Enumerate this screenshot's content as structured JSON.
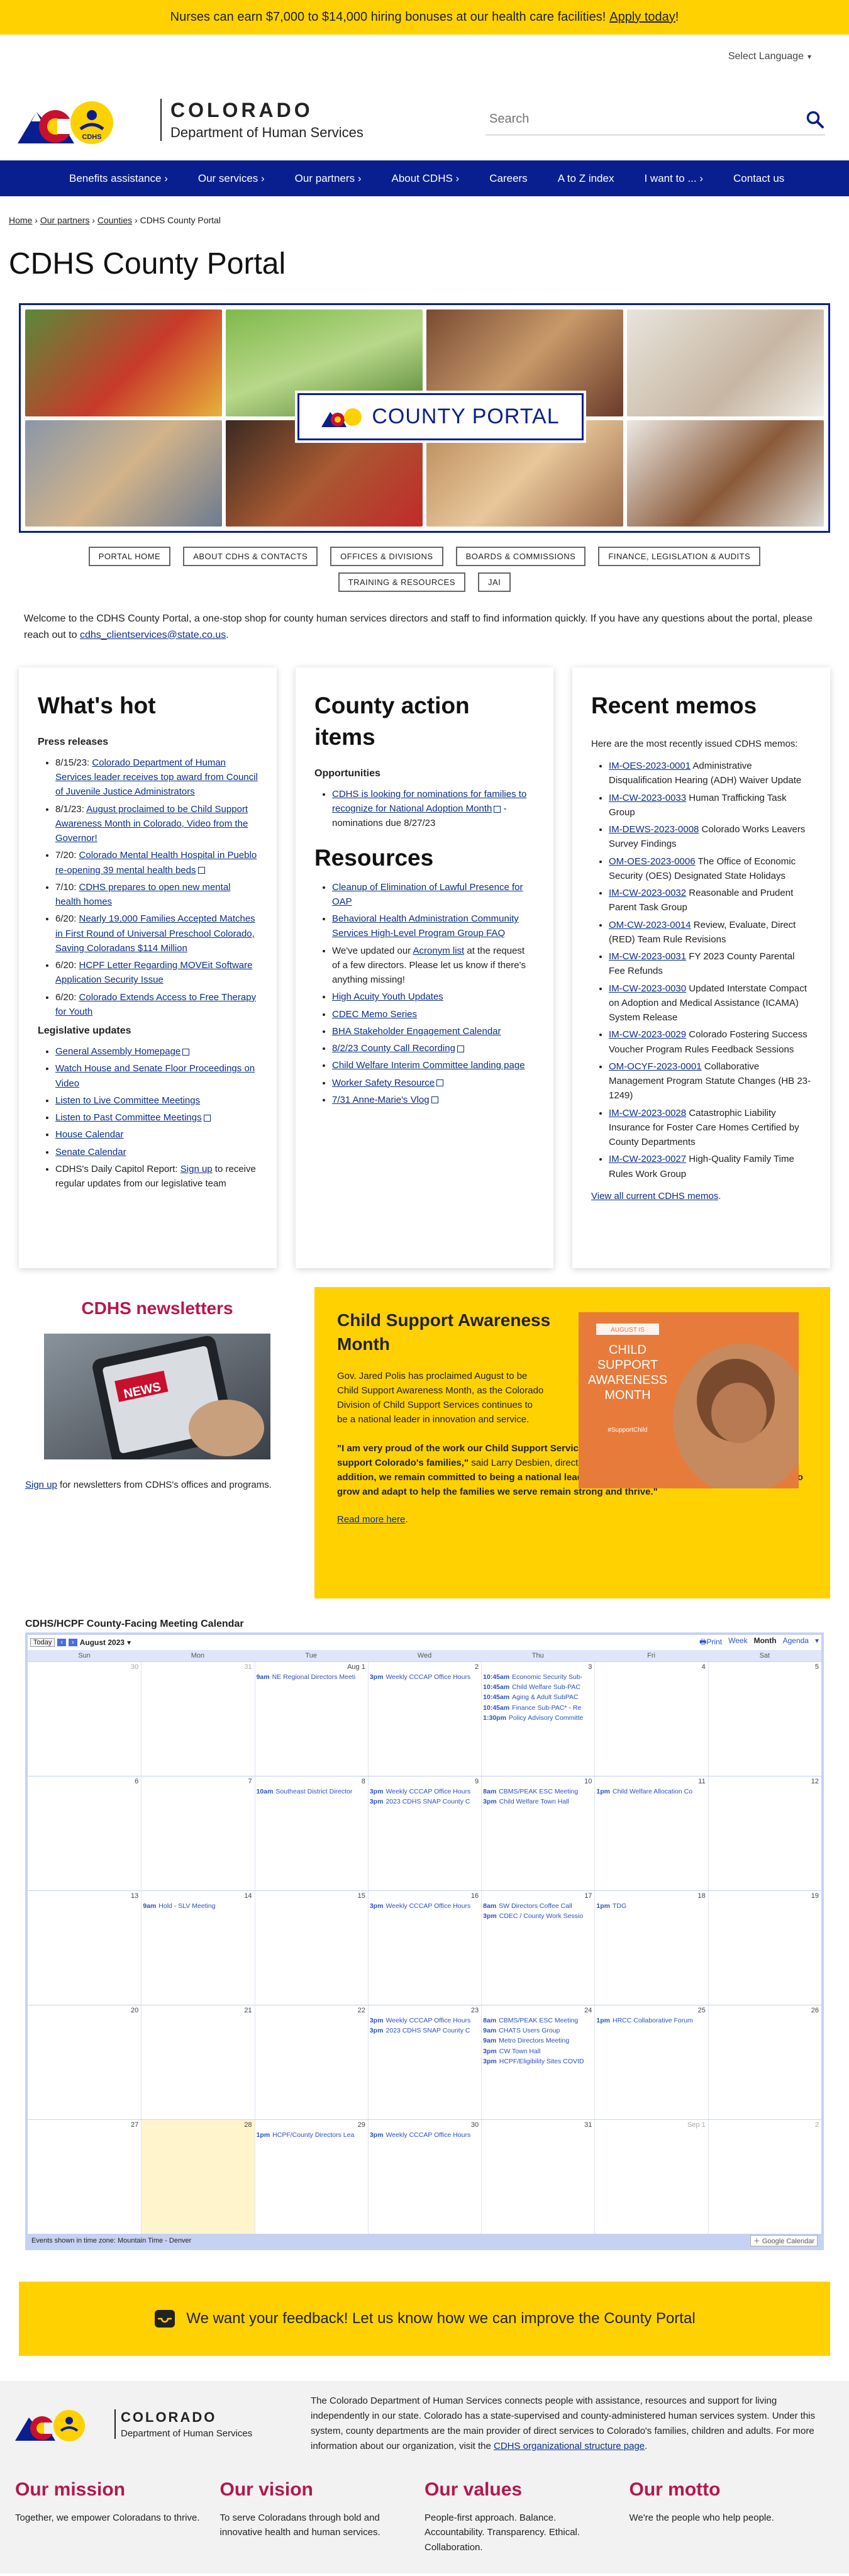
{
  "banner": {
    "text": "Nurses can earn $7,000 to $14,000 hiring bonuses at our health care facilities!",
    "link": "Apply today",
    "suffix": "!"
  },
  "language": {
    "label": "Select Language"
  },
  "logo": {
    "state": "COLORADO",
    "dept": "Department of Human Services",
    "badge": "CDHS"
  },
  "search": {
    "placeholder": "Search"
  },
  "nav": [
    "Benefits assistance",
    "Our services",
    "Our partners",
    "About CDHS",
    "Careers",
    "A to Z index",
    "I want to ...",
    "Contact us"
  ],
  "breadcrumb": {
    "home": "Home",
    "partners": "Our partners",
    "counties": "Counties",
    "current": "CDHS County Portal"
  },
  "page_title": "CDHS County Portal",
  "hero": {
    "badge": "COUNTY PORTAL"
  },
  "tabs": [
    "PORTAL HOME",
    "ABOUT CDHS & CONTACTS",
    "OFFICES & DIVISIONS",
    "BOARDS & COMMISSIONS",
    "FINANCE, LEGISLATION & AUDITS",
    "TRAINING & RESOURCES",
    "JAI"
  ],
  "intro": {
    "text": "Welcome to the CDHS County Portal, a one-stop shop for county human services directors and staff to find information quickly. If you have any questions about the portal, please reach out to ",
    "email": "cdhs_clientservices@state.co.us",
    "end": "."
  },
  "whats_hot": {
    "title": "What's hot",
    "press_heading": "Press releases",
    "press": [
      {
        "date": "8/15/23: ",
        "link": "Colorado Department of Human Services leader receives top award from Council of Juvenile Justice Administrators"
      },
      {
        "date": "8/1/23: ",
        "link": "August proclaimed to be Child Support Awareness Month in Colorado, Video from the Governor!"
      },
      {
        "date": "7/20: ",
        "link": "Colorado Mental Health Hospital in Pueblo re-opening 39 mental health beds"
      },
      {
        "date": "7/10: ",
        "link": "CDHS prepares to open new mental health homes"
      },
      {
        "date": "6/20: ",
        "link": "Nearly 19,000 Families Accepted Matches in First Round of Universal Preschool Colorado, Saving Coloradans $114 Million"
      },
      {
        "date": "6/20: ",
        "link": "HCPF Letter Regarding MOVEit Software Application Security Issue"
      },
      {
        "date": "6/20: ",
        "link": "Colorado Extends Access to Free Therapy for Youth"
      }
    ],
    "leg_heading": "Legislative updates",
    "leg": [
      "General Assembly Homepage",
      "Watch House and Senate Floor Proceedings on Video",
      "Listen to Live Committee Meetings",
      "Listen to Past Committee Meetings",
      "House Calendar",
      "Senate Calendar"
    ],
    "leg_tail": {
      "pre": "CDHS's Daily Capitol Report: ",
      "link": "Sign up",
      "post": " to receive regular updates from our legislative team"
    }
  },
  "county_action": {
    "title": "County action items",
    "opp_heading": "Opportunities",
    "opp_link": "CDHS is looking for nominations for families to recognize for National Adoption Month",
    "opp_tail": " - nominations due 8/27/23",
    "res_title": "Resources",
    "res": [
      "Cleanup of Elimination of Lawful Presence for OAP",
      "Behavioral Health Administration Community Services High-Level Program Group FAQ"
    ],
    "acr_pre": "We've updated our ",
    "acr_link": "Acronym list",
    "acr_post": " at the request of a few directors. Please let us know if there's anything missing!",
    "res2": [
      "High Acuity Youth Updates",
      "CDEC Memo Series",
      "BHA Stakeholder Engagement Calendar",
      "8/2/23 County Call Recording",
      "Child Welfare Interim Committee landing page",
      "Worker Safety Resource",
      "7/31 Anne-Marie's Vlog"
    ]
  },
  "memos": {
    "title": "Recent memos",
    "intro": "Here are the most recently issued CDHS memos:",
    "items": [
      {
        "id": "IM-OES-2023-0001",
        "text": " Administrative Disqualification Hearing (ADH) Waiver Update"
      },
      {
        "id": "IM-CW-2023-0033",
        "text": " Human Trafficking Task Group"
      },
      {
        "id": "IM-DEWS-2023-0008",
        "text": " Colorado Works Leavers Survey Findings"
      },
      {
        "id": "OM-OES-2023-0006",
        "text": " The Office of Economic Security (OES) Designated State Holidays"
      },
      {
        "id": "IM-CW-2023-0032",
        "text": " Reasonable and Prudent Parent Task Group"
      },
      {
        "id": "OM-CW-2023-0014",
        "text": " Review, Evaluate, Direct (RED) Team Rule Revisions"
      },
      {
        "id": "IM-CW-2023-0031",
        "text": " FY 2023 County Parental Fee Refunds"
      },
      {
        "id": "IM-CW-2023-0030",
        "text": " Updated Interstate Compact on Adoption and Medical Assistance (ICAMA) System Release"
      },
      {
        "id": "IM-CW-2023-0029",
        "text": " Colorado Fostering Success Voucher Program Rules Feedback Sessions"
      },
      {
        "id": "OM-OCYF-2023-0001",
        "text": " Collaborative Management Program Statute Changes (HB 23-1249)"
      },
      {
        "id": "IM-CW-2023-0028",
        "text": " Catastrophic Liability Insurance for Foster Care Homes Certified by County Departments"
      },
      {
        "id": "IM-CW-2023-0027",
        "text": " High-Quality Family Time Rules Work Group"
      }
    ],
    "view_all": "View all current CDHS memos"
  },
  "newsletter": {
    "title": "CDHS newsletters",
    "link": "Sign up",
    "text": " for newsletters from CDHS's offices and programs.",
    "img_label": "NEWS"
  },
  "feature": {
    "title": "Child Support Awareness Month",
    "lead": "Gov. Jared Polis has proclaimed August to be Child Support Awareness Month, as the Colorado Division of Child Support Services continues to be a national leader in innovation and service.",
    "quote1": "\"I am very proud of the work our Child Support Services team does alongside our county partners to support Colorado's families,\"",
    "said": " said Larry Desbien, director of the Division of Child Support Services. ",
    "quote2": "\"In addition, we remain committed to being a national leader when it comes to innovation as we continue to grow and adapt to help the families we serve remain strong and thrive.\"",
    "more": "Read more here",
    "img": {
      "month": "AUGUST IS",
      "l1": "CHILD",
      "l2": "SUPPORT",
      "l3": "AWARENESS",
      "l4": "MONTH",
      "tag": "#SupportChild"
    }
  },
  "calendar": {
    "title": "CDHS/HCPF County-Facing Meeting Calendar",
    "today": "Today",
    "month": "August 2023",
    "print": "Print",
    "views": [
      "Week",
      "Month",
      "Agenda"
    ],
    "dow": [
      "Sun",
      "Mon",
      "Tue",
      "Wed",
      "Thu",
      "Fri",
      "Sat"
    ],
    "weeks": [
      [
        {
          "n": "30",
          "other": true,
          "ev": []
        },
        {
          "n": "31",
          "other": true,
          "ev": []
        },
        {
          "n": "Aug 1",
          "ev": [
            {
              "t": "9am",
              "s": "NE Regional Directors Meeti"
            }
          ]
        },
        {
          "n": "2",
          "ev": [
            {
              "t": "3pm",
              "s": "Weekly CCCAP Office Hours"
            }
          ]
        },
        {
          "n": "3",
          "ev": [
            {
              "t": "10:45am",
              "s": "Economic Security Sub-"
            },
            {
              "t": "10:45am",
              "s": "Child Welfare Sub-PAC"
            },
            {
              "t": "10:45am",
              "s": "Aging & Adult SubPAC"
            },
            {
              "t": "10:45am",
              "s": "Finance Sub-PAC* - Re"
            },
            {
              "t": "1:30pm",
              "s": "Policy Advisory Committe"
            }
          ]
        },
        {
          "n": "4",
          "ev": []
        },
        {
          "n": "5",
          "ev": []
        }
      ],
      [
        {
          "n": "6",
          "ev": []
        },
        {
          "n": "7",
          "ev": []
        },
        {
          "n": "8",
          "ev": [
            {
              "t": "10am",
              "s": "Southeast District Director"
            }
          ]
        },
        {
          "n": "9",
          "ev": [
            {
              "t": "3pm",
              "s": "Weekly CCCAP Office Hours"
            },
            {
              "t": "3pm",
              "s": "2023 CDHS SNAP County C"
            }
          ]
        },
        {
          "n": "10",
          "ev": [
            {
              "t": "8am",
              "s": "CBMS/PEAK ESC Meeting"
            },
            {
              "t": "3pm",
              "s": "Child Welfare Town Hall"
            }
          ]
        },
        {
          "n": "11",
          "ev": [
            {
              "t": "1pm",
              "s": "Child Welfare Allocation Co"
            }
          ]
        },
        {
          "n": "12",
          "ev": []
        }
      ],
      [
        {
          "n": "13",
          "ev": []
        },
        {
          "n": "14",
          "ev": [
            {
              "t": "9am",
              "s": "Hold - SLV Meeting"
            }
          ]
        },
        {
          "n": "15",
          "ev": []
        },
        {
          "n": "16",
          "ev": [
            {
              "t": "3pm",
              "s": "Weekly CCCAP Office Hours"
            }
          ]
        },
        {
          "n": "17",
          "ev": [
            {
              "t": "8am",
              "s": "SW Directors Coffee Call"
            },
            {
              "t": "3pm",
              "s": "CDEC / County Work Sessio"
            }
          ]
        },
        {
          "n": "18",
          "ev": [
            {
              "t": "1pm",
              "s": "TDG"
            }
          ]
        },
        {
          "n": "19",
          "ev": []
        }
      ],
      [
        {
          "n": "20",
          "ev": []
        },
        {
          "n": "21",
          "ev": []
        },
        {
          "n": "22",
          "ev": []
        },
        {
          "n": "23",
          "ev": [
            {
              "t": "3pm",
              "s": "Weekly CCCAP Office Hours"
            },
            {
              "t": "3pm",
              "s": "2023 CDHS SNAP County C"
            }
          ]
        },
        {
          "n": "24",
          "ev": [
            {
              "t": "8am",
              "s": "CBMS/PEAK ESC Meeting"
            },
            {
              "t": "9am",
              "s": "CHATS Users Group"
            },
            {
              "t": "9am",
              "s": "Metro Directors Meeting"
            },
            {
              "t": "3pm",
              "s": "CW Town Hall"
            },
            {
              "t": "3pm",
              "s": "HCPF/Eligibility Sites COVID"
            }
          ]
        },
        {
          "n": "25",
          "ev": [
            {
              "t": "1pm",
              "s": "HRCC Collaborative Forum"
            }
          ]
        },
        {
          "n": "26",
          "ev": []
        }
      ],
      [
        {
          "n": "27",
          "ev": []
        },
        {
          "n": "28",
          "today": true,
          "ev": []
        },
        {
          "n": "29",
          "ev": [
            {
              "t": "1pm",
              "s": "HCPF/County Directors Lea"
            }
          ]
        },
        {
          "n": "30",
          "ev": [
            {
              "t": "3pm",
              "s": "Weekly CCCAP Office Hours"
            }
          ]
        },
        {
          "n": "31",
          "ev": []
        },
        {
          "n": "Sep 1",
          "other": true,
          "ev": []
        },
        {
          "n": "2",
          "other": true,
          "ev": []
        }
      ]
    ],
    "tz": "Events shown in time zone: Mountain Time - Denver",
    "gcal": "Google Calendar"
  },
  "feedback": {
    "text": "We want your feedback! Let us know how we can improve the County Portal"
  },
  "footer": {
    "about": "The Colorado Department of Human Services connects people with assistance, resources and support for living independently in our state. Colorado has a state-supervised and county-administered human services system. Under this system, county departments are the main provider of direct services to Colorado's families, children and adults. For more information about our organization, visit the ",
    "about_link": "CDHS organizational structure page",
    "about_end": ".",
    "values": [
      {
        "title": "Our mission",
        "text": "Together, we empower Coloradans to thrive."
      },
      {
        "title": "Our vision",
        "text": "To serve Coloradans through bold and innovative health and human services."
      },
      {
        "title": "Our values",
        "text": "People-first approach. Balance. Accountability. Transparency. Ethical. Collaboration."
      },
      {
        "title": "Our motto",
        "text": "We're the people who help people."
      }
    ]
  },
  "colors": {
    "navy": "#0a1f8f",
    "gold": "#ffd100",
    "crimson": "#b5174b",
    "link": "#0b2f8a"
  }
}
